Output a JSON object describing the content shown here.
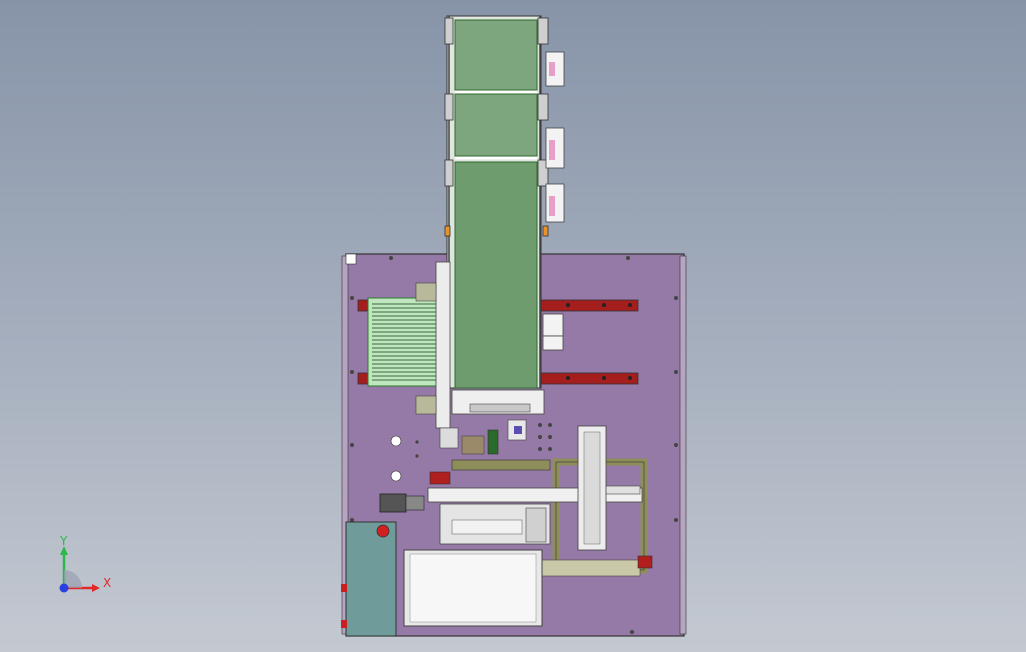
{
  "viewport": {
    "background_top": "#8794a8",
    "background_bottom": "#c4c9d1"
  },
  "triad": {
    "x_label": "X",
    "y_label": "Y",
    "x_color": "#e02a2a",
    "y_color": "#2ab84a",
    "z_color": "#2a3fe0"
  },
  "model": {
    "base_plate_color": "#9579a6",
    "conveyor_color": "#6e9c6e",
    "rail_color": "#a41e1e",
    "frame_color": "#8e8e5a",
    "electric_box_color": "#6f9b9a",
    "enclosure_color": "#e8e8e8",
    "stop_button_color": "#d22020"
  }
}
